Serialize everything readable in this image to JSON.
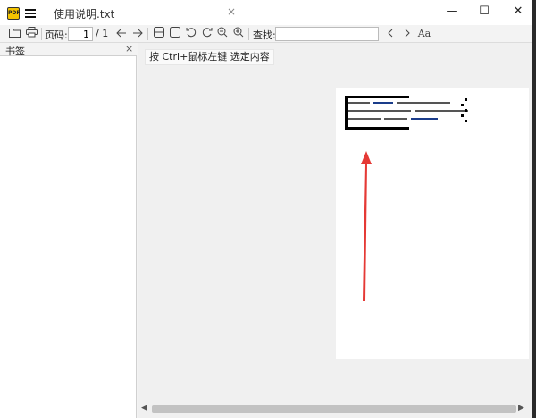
{
  "window": {
    "tab_title": "使用说明.txt",
    "tab_close": "×",
    "minimize": "—",
    "maximize": "☐",
    "close": "✕",
    "logo_text": "PDF"
  },
  "toolbar": {
    "page_label": "页码:",
    "page_current": "1",
    "page_total": "/ 1",
    "find_label": "查找:",
    "find_placeholder": "",
    "icons": [
      "folder-icon",
      "print-icon",
      "arrow-left-icon",
      "arrow-right-icon",
      "single-page-icon",
      "fit-page-icon",
      "rotate-left-icon",
      "rotate-right-icon",
      "zoom-out-icon",
      "zoom-in-icon",
      "prev-result-icon",
      "next-result-icon",
      "font-size-icon"
    ]
  },
  "bookmarks": {
    "title": "书签",
    "close": "×"
  },
  "document": {
    "hint": "按 Ctrl+鼠标左键 选定内容"
  },
  "colors": {
    "arrow": "#e53935",
    "logo": "#f4c400"
  }
}
